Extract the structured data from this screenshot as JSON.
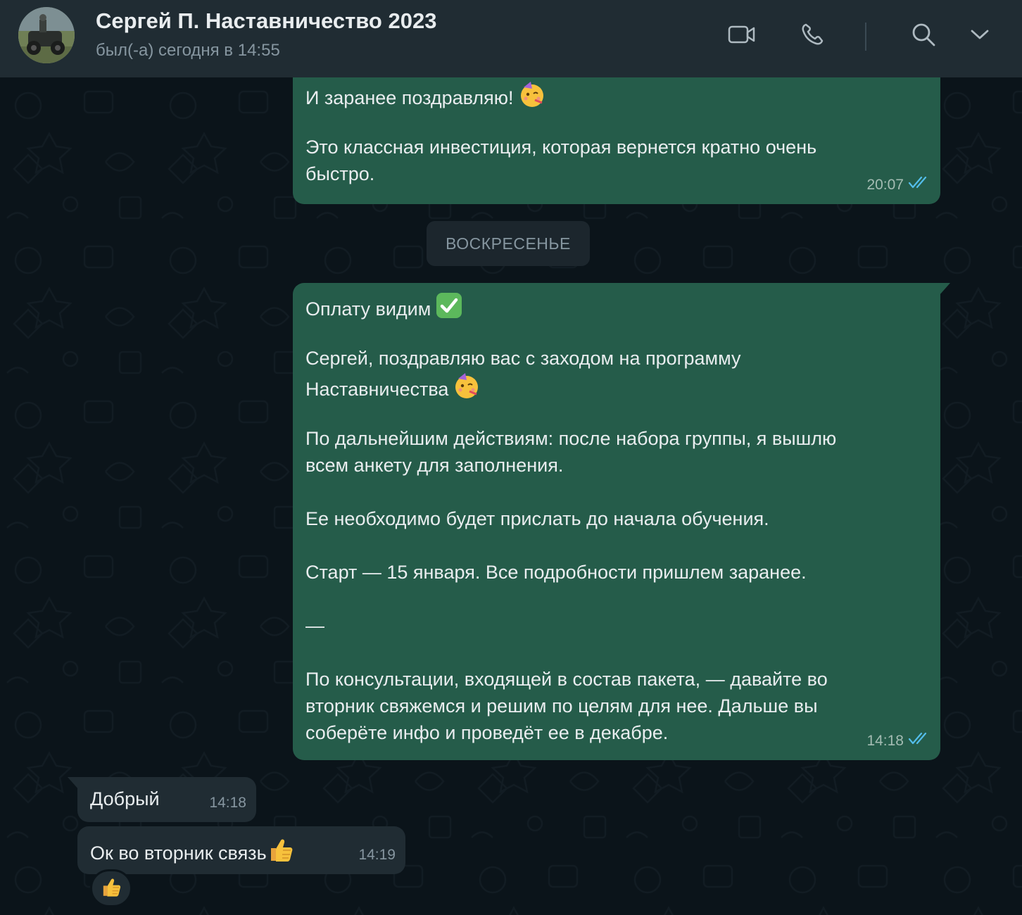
{
  "header": {
    "title": "Сергей П. Наставничество 2023",
    "status": "был(-а) сегодня в 14:55",
    "icons": [
      "video-call-icon",
      "voice-call-icon",
      "search-icon",
      "chevron-down-icon"
    ]
  },
  "date_divider": "ВОСКРЕСЕНЬЕ",
  "messages": {
    "m1": {
      "direction": "outgoing",
      "lines": [
        "И заранее поздравляю!",
        "",
        "Это классная инвестиция, которая вернется кратно очень",
        "быстро."
      ],
      "emoji": "partying-face",
      "time": "20:07",
      "status": "read"
    },
    "m2": {
      "direction": "outgoing",
      "lines": [
        "Оплату видим",
        "",
        "Сергей, поздравляю вас с заходом на программу",
        "Наставничества",
        "",
        "По дальнейшим действиям: после набора группы, я вышлю",
        "всем анкету для заполнения.",
        "",
        "Ее необходимо будет прислать до начала обучения.",
        "",
        "Старт — 15 января. Все подробности пришлем заранее.",
        "",
        "—",
        "",
        "По консультации, входящей в состав пакета, — давайте во",
        "вторник свяжемся и решим по целям для нее. Дальше вы",
        "соберёте инфо и проведёт ее в декабре."
      ],
      "emojis": [
        "check-mark-button",
        "partying-face"
      ],
      "time": "14:18",
      "status": "read"
    },
    "m3": {
      "direction": "incoming",
      "text": "Добрый",
      "time": "14:18"
    },
    "m4": {
      "direction": "incoming",
      "text": "Ок во вторник связь",
      "emoji": "thumbs-up",
      "time": "14:19",
      "reaction": "thumbs-up"
    }
  },
  "colors": {
    "header_bg": "#202c33",
    "chat_bg": "#0b141a",
    "outgoing_bubble": "#255c4a",
    "incoming_bubble": "#202c33",
    "read_ticks": "#53bdeb"
  }
}
